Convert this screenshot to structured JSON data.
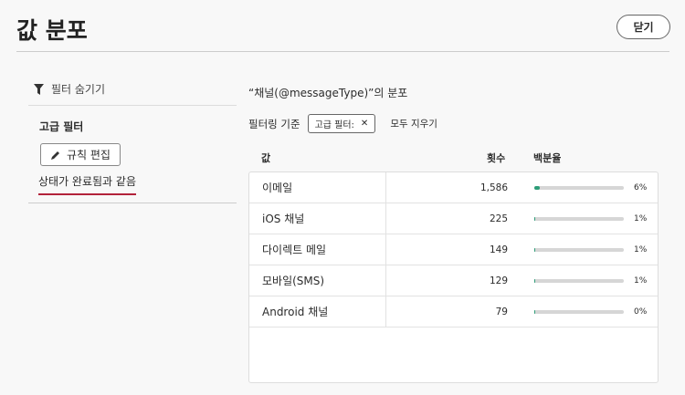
{
  "header": {
    "title": "값 분포",
    "close_label": "닫기"
  },
  "sidebar": {
    "hide_filters": "필터 숨기기",
    "advanced_filter": "고급 필터",
    "edit_rules": "규칙 편집",
    "condition": "상태가 완료됨과 같음"
  },
  "main": {
    "distribution_title": "“채널(@messageType)”의 분포",
    "filter_by": "필터링 기준",
    "filter_tag": "고급 필터:",
    "clear_all": "모두 지우기",
    "columns": {
      "value": "값",
      "count": "횟수",
      "percent": "백분율"
    },
    "rows": [
      {
        "value": "이메일",
        "count": "1,586",
        "percent": "6%",
        "fraction": 0.06
      },
      {
        "value": "iOS 채널",
        "count": "225",
        "percent": "1%",
        "fraction": 0.01
      },
      {
        "value": "다이렉트 메일",
        "count": "149",
        "percent": "1%",
        "fraction": 0.01
      },
      {
        "value": "모바일(SMS)",
        "count": "129",
        "percent": "1%",
        "fraction": 0.01
      },
      {
        "value": "Android 채널",
        "count": "79",
        "percent": "0%",
        "fraction": 0.0
      }
    ]
  },
  "colors": {
    "accent": "#2d9d78",
    "underline": "#b2223a"
  }
}
